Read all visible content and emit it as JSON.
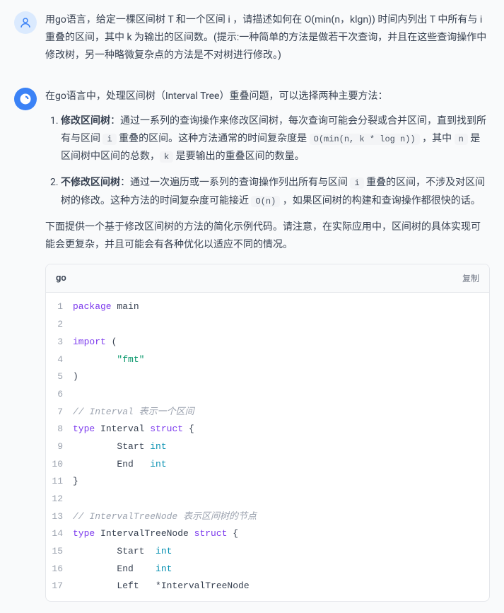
{
  "user": {
    "text": "用go语言，给定一棵区间树 T 和一个区间 i ，请描述如何在 O(min(n，klgn)) 时间内列出 T 中所有与 i 重叠的区间，其中 k 为输出的区间数。(提示:一种简单的方法是做若干次查询，并且在这些查询操作中修改树，另一种略微复杂点的方法是不对树进行修改。)"
  },
  "ai": {
    "intro": "在go语言中，处理区间树（Interval Tree）重叠问题，可以选择两种主要方法：",
    "item1_prefix": "修改区间树",
    "item1_body_a": "：通过一系列的查询操作来修改区间树，每次查询可能会分裂或合并区间，直到找到所有与区间 ",
    "item1_code1": "i",
    "item1_body_b": " 重叠的区间。这种方法通常的时间复杂度是 ",
    "item1_code2": "O(min(n, k * log n))",
    "item1_body_c": " ，其中 ",
    "item1_code3": "n",
    "item1_body_d": " 是区间树中区间的总数，",
    "item1_code4": "k",
    "item1_body_e": " 是要输出的重叠区间的数量。",
    "item2_prefix": "不修改区间树",
    "item2_body_a": "：通过一次遍历或一系列的查询操作列出所有与区间 ",
    "item2_code1": "i",
    "item2_body_b": " 重叠的区间，不涉及对区间树的修改。这种方法的时间复杂度可能接近 ",
    "item2_code2": "O(n)",
    "item2_body_c": " ，如果区间树的构建和查询操作都很快的话。",
    "outro": "下面提供一个基于修改区间树的方法的简化示例代码。请注意，在实际应用中，区间树的具体实现可能会更复杂，并且可能会有各种优化以适应不同的情况。"
  },
  "code": {
    "lang": "go",
    "copy": "复制",
    "lines": {
      "l1": {
        "kw": "package",
        "rest": " main"
      },
      "l3": {
        "kw": "import",
        "rest": " ("
      },
      "l4": {
        "str": "\"fmt\""
      },
      "l5": {
        "plain": ")"
      },
      "l7": {
        "cmt": "// Interval 表示一个区间"
      },
      "l8": {
        "kw": "type",
        "name": " Interval ",
        "kw2": "struct",
        "rest": " {"
      },
      "l9": {
        "field": "        Start ",
        "typ": "int"
      },
      "l10": {
        "field": "        End   ",
        "typ": "int"
      },
      "l11": {
        "plain": "}"
      },
      "l13": {
        "cmt": "// IntervalTreeNode 表示区间树的节点"
      },
      "l14": {
        "kw": "type",
        "name": " IntervalTreeNode ",
        "kw2": "struct",
        "rest": " {"
      },
      "l15": {
        "field": "        Start  ",
        "typ": "int"
      },
      "l16": {
        "field": "        End    ",
        "typ": "int"
      },
      "l17": {
        "field": "        Left   *IntervalTreeNode"
      }
    }
  }
}
